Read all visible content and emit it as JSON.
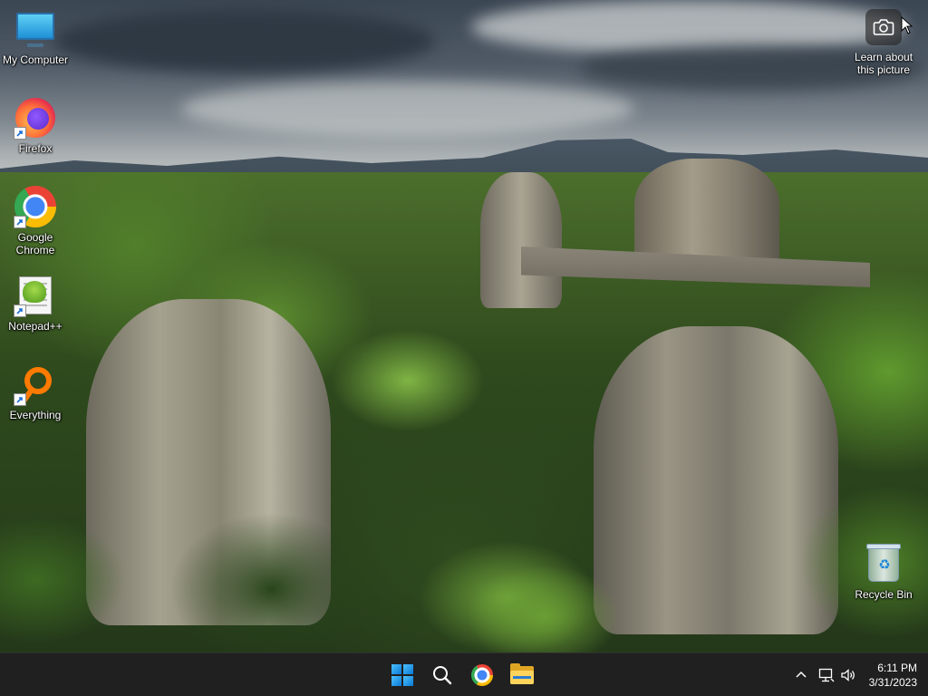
{
  "desktop": {
    "icons": [
      {
        "label": "My Computer",
        "icon": "monitor-icon",
        "shortcut": false
      },
      {
        "label": "Firefox",
        "icon": "firefox-icon",
        "shortcut": true
      },
      {
        "label": "Google Chrome",
        "icon": "chrome-icon",
        "shortcut": true
      },
      {
        "label": "Notepad++",
        "icon": "notepadpp-icon",
        "shortcut": true
      },
      {
        "label": "Everything",
        "icon": "everything-icon",
        "shortcut": true
      },
      {
        "label": "Recycle Bin",
        "icon": "recycle-bin-icon",
        "shortcut": false
      }
    ],
    "learn_about_picture": {
      "label": "Learn about this picture",
      "icon": "camera-icon"
    }
  },
  "taskbar": {
    "pinned": [
      {
        "name": "Start",
        "icon": "windows-start-icon"
      },
      {
        "name": "Search",
        "icon": "search-icon"
      },
      {
        "name": "Google Chrome",
        "icon": "chrome-icon"
      },
      {
        "name": "File Explorer",
        "icon": "file-explorer-icon"
      }
    ],
    "tray": {
      "overflow_icon": "chevron-up-icon",
      "network_icon": "network-icon",
      "volume_icon": "volume-icon"
    },
    "clock": {
      "time": "6:11 PM",
      "date": "3/31/2023"
    }
  },
  "colors": {
    "taskbar_bg": "#202020",
    "windows_accent": "#0a78d4",
    "label_text": "#ffffff"
  }
}
